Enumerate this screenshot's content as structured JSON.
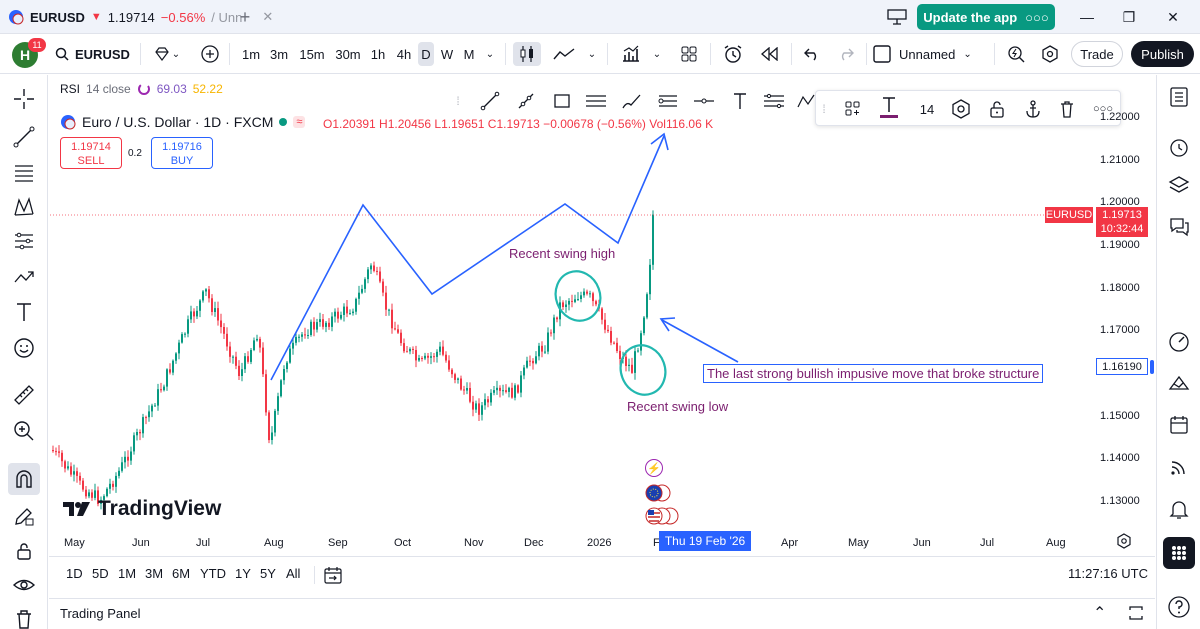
{
  "titlebar": {
    "tab_symbol": "EURUSD",
    "tab_price": "1.19714",
    "tab_change": "−0.56%",
    "tab_suffix": "/ Unn",
    "update_label": "Update the app"
  },
  "toolbar": {
    "avatar_letter": "H",
    "avatar_badge": "11",
    "symbol": "EURUSD",
    "intervals": [
      "1m",
      "3m",
      "15m",
      "30m",
      "1h",
      "4h",
      "D",
      "W",
      "M"
    ],
    "active_interval": "D",
    "layout_name": "Unnamed",
    "trade_label": "Trade",
    "publish_label": "Publish"
  },
  "legend": {
    "rsi_label": "RSI",
    "rsi_params": "14 close",
    "rsi_value1": "69.03",
    "rsi_value2": "52.22",
    "title": "Euro / U.S. Dollar · 1D · FXCM",
    "ohlc": "O1.20391 H1.20456 L1.19651 C1.19713 −0.00678 (−0.56%) Vol116.06 K",
    "sell_price": "1.19714",
    "sell_label": "SELL",
    "spread": "0.2",
    "buy_price": "1.19716",
    "buy_label": "BUY"
  },
  "text_toolbar": {
    "font_size": "14"
  },
  "price_scale": {
    "labels": [
      "1.22000",
      "1.21000",
      "1.20000",
      "1.19000",
      "1.18000",
      "1.17000",
      "1.15000",
      "1.14000",
      "1.13000"
    ],
    "current_symbol": "EURUSD",
    "current_price": "1.19713",
    "countdown": "10:32:44",
    "marker_price": "1.16190"
  },
  "time_axis": {
    "labels": [
      "May",
      "Jun",
      "Jul",
      "Aug",
      "Sep",
      "Oct",
      "Nov",
      "Dec",
      "2026",
      "F",
      "Apr",
      "May",
      "Jun",
      "Jul",
      "Aug"
    ],
    "crosshair_date": "Thu 19 Feb '26"
  },
  "annotations": {
    "swing_high": "Recent swing high",
    "swing_low": "Recent swing low",
    "box_note": "The last strong bullish impusive move that broke structure"
  },
  "logo_text": "TradingView",
  "bottombar": {
    "ranges": [
      "1D",
      "5D",
      "1M",
      "3M",
      "6M",
      "YTD",
      "1Y",
      "5Y",
      "All"
    ],
    "clock": "11:27:16 UTC"
  },
  "trading_panel_label": "Trading Panel",
  "colors": {
    "up": "#089981",
    "down": "#f23645",
    "accent": "#2962ff",
    "annotation": "#7b1e6f",
    "highlight_circle": "#22b8b0"
  }
}
